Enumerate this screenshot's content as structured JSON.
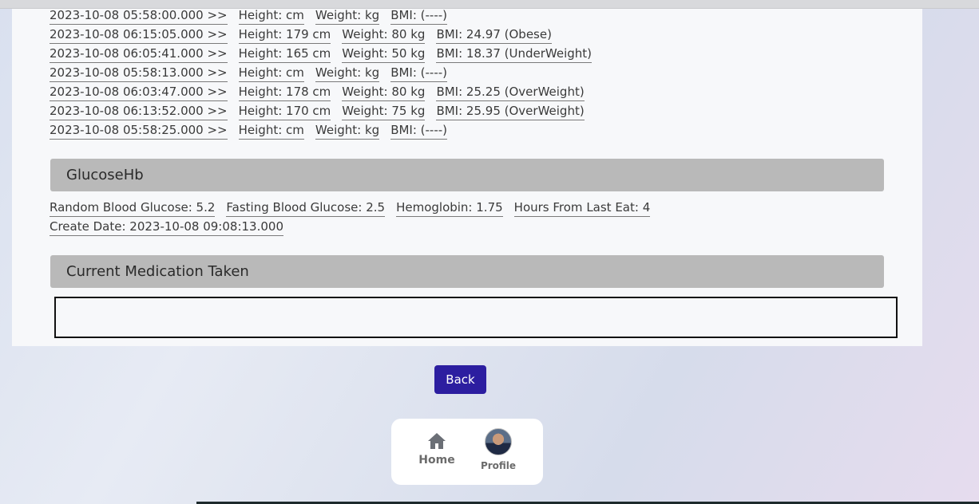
{
  "bmi_rows": [
    {
      "date": "2023-10-08 05:58:00.000 >>",
      "height": "Height: cm",
      "weight": "Weight: kg",
      "bmi": "BMI: (----)"
    },
    {
      "date": "2023-10-08 06:15:05.000 >>",
      "height": "Height: 179 cm",
      "weight": "Weight: 80 kg",
      "bmi": "BMI: 24.97 (Obese)"
    },
    {
      "date": "2023-10-08 06:05:41.000 >>",
      "height": "Height: 165 cm",
      "weight": "Weight: 50 kg",
      "bmi": "BMI: 18.37 (UnderWeight)"
    },
    {
      "date": "2023-10-08 05:58:13.000 >>",
      "height": "Height: cm",
      "weight": "Weight: kg",
      "bmi": "BMI: (----)"
    },
    {
      "date": "2023-10-08 06:03:47.000 >>",
      "height": "Height: 178 cm",
      "weight": "Weight: 80 kg",
      "bmi": "BMI: 25.25 (OverWeight)"
    },
    {
      "date": "2023-10-08 06:13:52.000 >>",
      "height": "Height: 170 cm",
      "weight": "Weight: 75 kg",
      "bmi": "BMI: 25.95 (OverWeight)"
    },
    {
      "date": "2023-10-08 05:58:25.000 >>",
      "height": "Height: cm",
      "weight": "Weight: kg",
      "bmi": "BMI: (----)"
    }
  ],
  "glucose_section": {
    "title": "GlucoseHb",
    "random_glucose": "Random Blood Glucose: 5.2",
    "fasting_glucose": "Fasting Blood Glucose: 2.5",
    "hemoglobin": "Hemoglobin: 1.75",
    "hours_from_last_eat": "Hours From Last Eat: 4",
    "create_date": "Create Date: 2023-10-08 09:08:13.000"
  },
  "medication_section": {
    "title": "Current Medication Taken",
    "value": ""
  },
  "back_button": "Back",
  "nav": {
    "home_label": "Home",
    "home_icon": "home-icon",
    "profile_label": "Profile",
    "profile_icon": "avatar"
  },
  "colors": {
    "button": "#2c1ea0",
    "header": "#b9b9b9",
    "card": "#f7f8fa"
  }
}
